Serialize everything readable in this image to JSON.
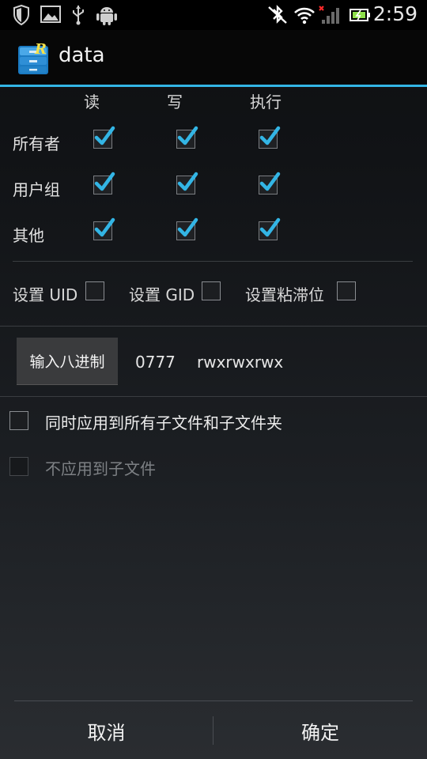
{
  "status_bar": {
    "time": "2:59",
    "icons": [
      "shield-icon",
      "image-icon",
      "usb-icon",
      "android-icon",
      "bluetooth-icon",
      "wifi-icon",
      "signal-icon",
      "battery-icon"
    ]
  },
  "action_bar": {
    "title": "data",
    "icon": "root-explorer-icon",
    "accent_color": "#33b5e5"
  },
  "permissions": {
    "columns": [
      "读",
      "写",
      "执行"
    ],
    "rows": [
      {
        "label": "所有者",
        "values": [
          true,
          true,
          true
        ]
      },
      {
        "label": "用户组",
        "values": [
          true,
          true,
          true
        ]
      },
      {
        "label": "其他",
        "values": [
          true,
          true,
          true
        ]
      }
    ],
    "check_color": "#33b5e5"
  },
  "special_flags": [
    {
      "label": "设置 UID",
      "checked": false
    },
    {
      "label": "设置 GID",
      "checked": false
    },
    {
      "label": "设置粘滞位",
      "checked": false
    }
  ],
  "octal": {
    "button_label": "输入八进制",
    "value": "0777",
    "symbolic": "rwxrwxrwx"
  },
  "options": [
    {
      "label": "同时应用到所有子文件和子文件夹",
      "checked": false,
      "enabled": true
    },
    {
      "label": "不应用到子文件",
      "checked": false,
      "enabled": false
    }
  ],
  "footer": {
    "cancel_label": "取消",
    "ok_label": "确定"
  }
}
